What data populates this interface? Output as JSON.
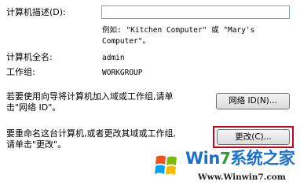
{
  "form": {
    "description_label": "计算机描述(D):",
    "description_value": "",
    "example_line1": "例如: \"Kitchen Computer\" 或 \"Mary's",
    "example_line2": "Computer\"。",
    "fullname_label": "计算机全名:",
    "fullname_value": "admin",
    "workgroup_label": "工作组:",
    "workgroup_value": "WORKGROUP"
  },
  "network": {
    "text_line1": "若要使用向导将计算机加入域或工作组,请单",
    "text_line2": "击\"网络 ID\"。",
    "button_label": "网络 ID(N)..."
  },
  "rename": {
    "text_line1": "要重命名这台计算机,或者更改其域或工作组,",
    "text_line2": "请单击\"更改\"。",
    "button_label": "更改(C)..."
  },
  "watermark": {
    "title_part1": "Win",
    "title_part2": "7",
    "title_part3": "系统之家",
    "url": "Www.Winwin7.com"
  },
  "colors": {
    "highlight": "#d0021b",
    "watermark_blue": "#1a6fd0",
    "watermark_green": "#2e9e3a"
  }
}
